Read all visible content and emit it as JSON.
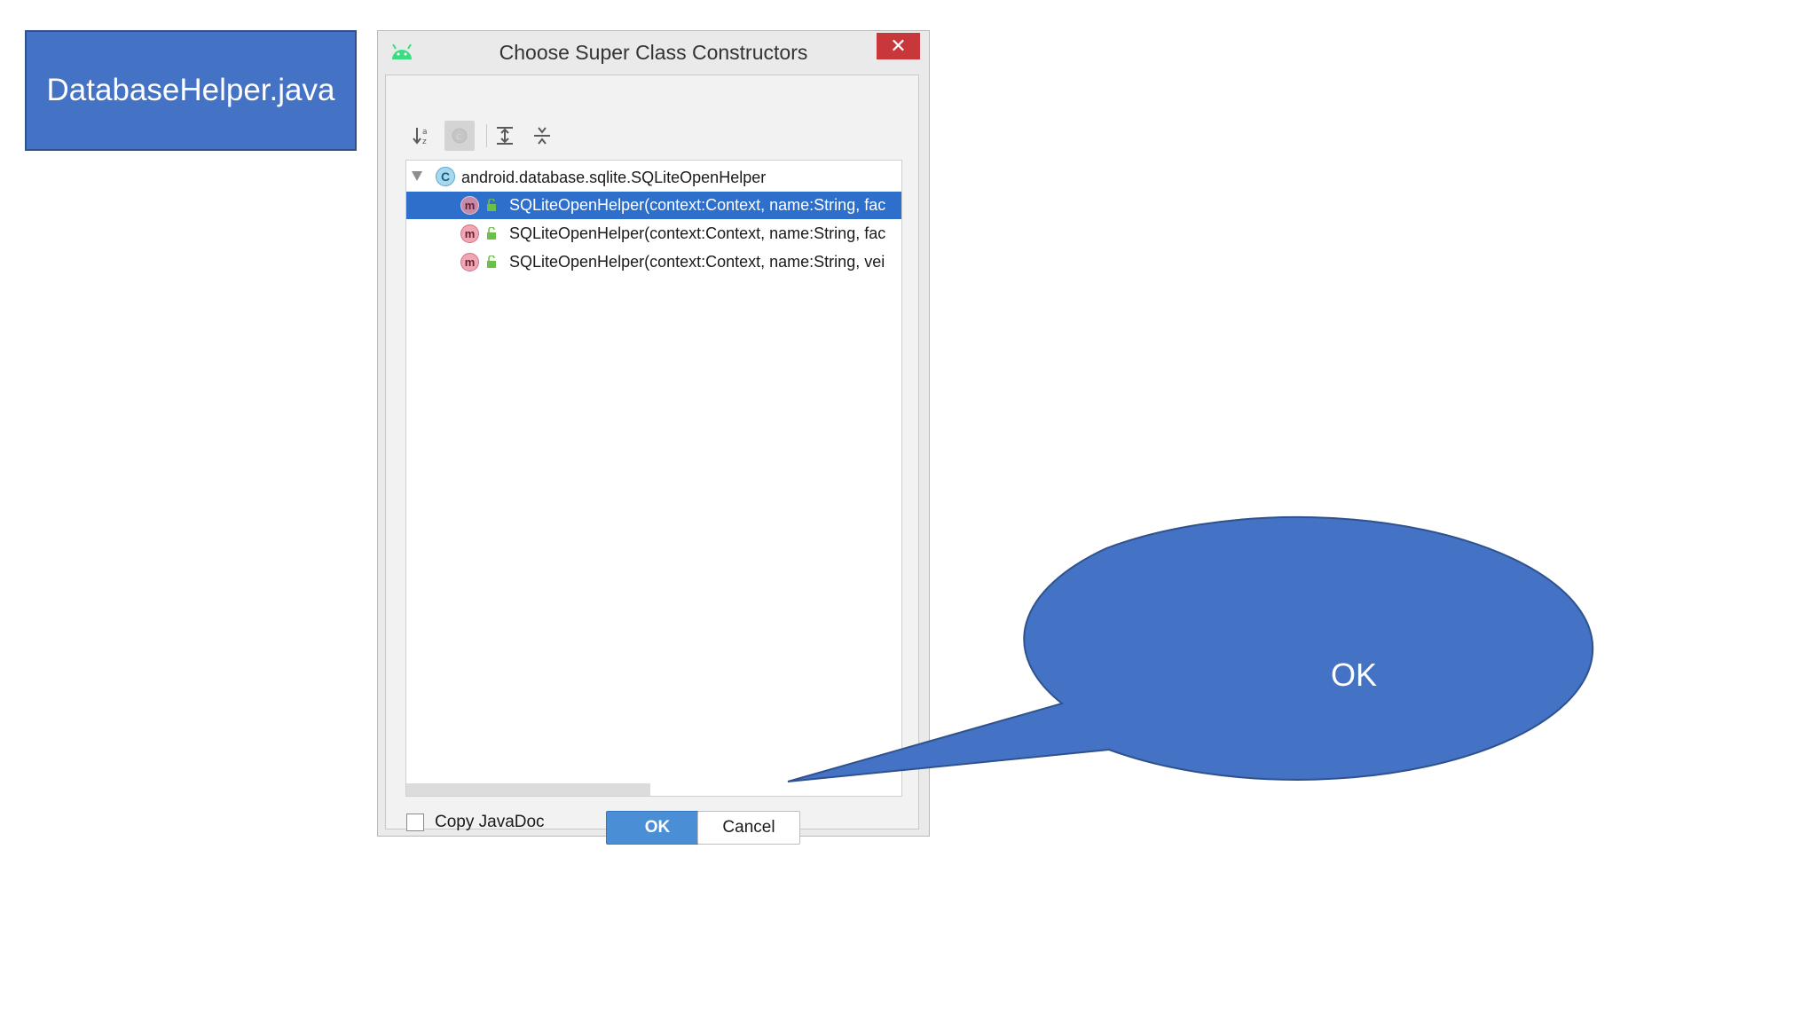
{
  "slide": {
    "file_label": "DatabaseHelper.java",
    "callout_text": "OK",
    "colors": {
      "shape_fill": "#4472c4",
      "shape_border": "#2f528f",
      "selection": "#2e6fcc"
    }
  },
  "dialog": {
    "title": "Choose Super Class Constructors",
    "app_icon": "android-icon",
    "close_label": "✕",
    "toolbar": [
      {
        "name": "sort-alphabetically-icon",
        "active": false
      },
      {
        "name": "show-classes-icon",
        "active": true
      },
      {
        "name": "expand-all-icon",
        "active": false
      },
      {
        "name": "collapse-all-icon",
        "active": false
      }
    ],
    "tree": {
      "class_icon": "C",
      "class_name": "android.database.sqlite.SQLiteOpenHelper",
      "method_icon": "m",
      "methods": [
        {
          "label": "SQLiteOpenHelper(context:Context, name:String, fac",
          "selected": true
        },
        {
          "label": "SQLiteOpenHelper(context:Context, name:String, fac",
          "selected": false
        },
        {
          "label": "SQLiteOpenHelper(context:Context, name:String, vei",
          "selected": false
        }
      ]
    },
    "copy_javadoc_label": "Copy JavaDoc",
    "copy_javadoc_checked": false,
    "ok_label": "OK",
    "cancel_label": "Cancel"
  }
}
